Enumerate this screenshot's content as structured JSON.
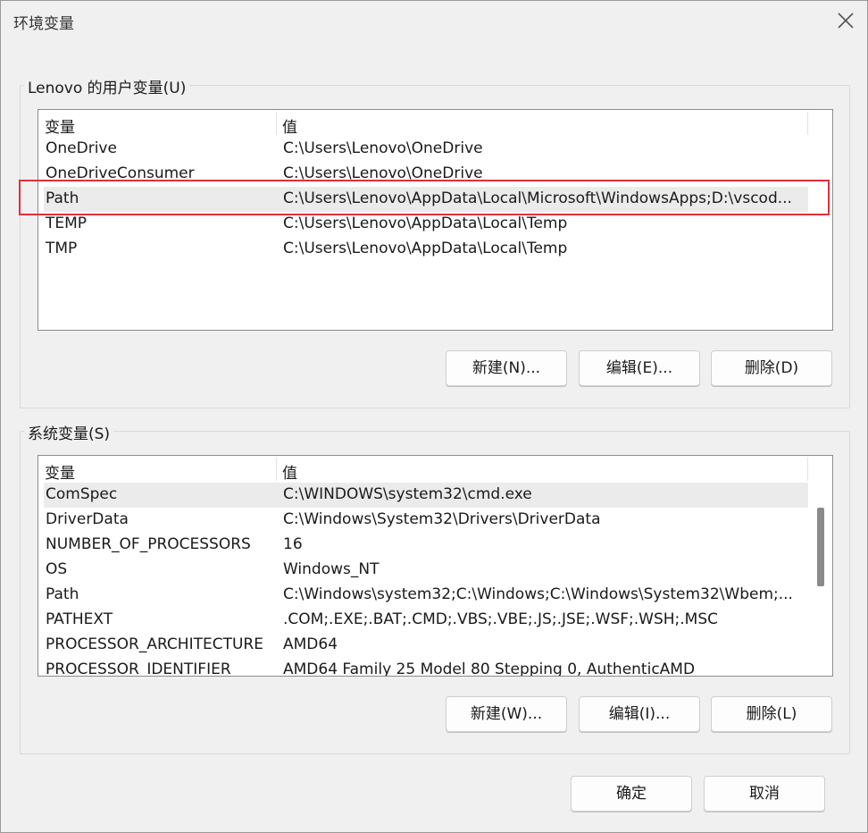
{
  "window": {
    "title": "环境变量"
  },
  "user_vars": {
    "group_label": "Lenovo 的用户变量(U)",
    "col_variable": "变量",
    "col_value": "值",
    "rows": [
      {
        "name": "OneDrive",
        "value": "C:\\Users\\Lenovo\\OneDrive"
      },
      {
        "name": "OneDriveConsumer",
        "value": "C:\\Users\\Lenovo\\OneDrive"
      },
      {
        "name": "Path",
        "value": "C:\\Users\\Lenovo\\AppData\\Local\\Microsoft\\WindowsApps;D:\\vscod..."
      },
      {
        "name": "TEMP",
        "value": "C:\\Users\\Lenovo\\AppData\\Local\\Temp"
      },
      {
        "name": "TMP",
        "value": "C:\\Users\\Lenovo\\AppData\\Local\\Temp"
      }
    ],
    "new_label": "新建(N)...",
    "edit_label": "编辑(E)...",
    "delete_label": "删除(D)"
  },
  "system_vars": {
    "group_label": "系统变量(S)",
    "col_variable": "变量",
    "col_value": "值",
    "rows": [
      {
        "name": "ComSpec",
        "value": "C:\\WINDOWS\\system32\\cmd.exe"
      },
      {
        "name": "DriverData",
        "value": "C:\\Windows\\System32\\Drivers\\DriverData"
      },
      {
        "name": "NUMBER_OF_PROCESSORS",
        "value": "16"
      },
      {
        "name": "OS",
        "value": "Windows_NT"
      },
      {
        "name": "Path",
        "value": "C:\\Windows\\system32;C:\\Windows;C:\\Windows\\System32\\Wbem;..."
      },
      {
        "name": "PATHEXT",
        "value": ".COM;.EXE;.BAT;.CMD;.VBS;.VBE;.JS;.JSE;.WSF;.WSH;.MSC"
      },
      {
        "name": "PROCESSOR_ARCHITECTURE",
        "value": "AMD64"
      },
      {
        "name": "PROCESSOR_IDENTIFIER",
        "value": "AMD64 Family 25 Model 80 Stepping 0, AuthenticAMD"
      }
    ],
    "new_label": "新建(W)...",
    "edit_label": "编辑(I)...",
    "delete_label": "删除(L)"
  },
  "footer": {
    "ok_label": "确定",
    "cancel_label": "取消"
  },
  "icons": {
    "close": "close-icon"
  },
  "colors": {
    "highlight": "#e0303a",
    "selected_row": "#ebebeb"
  }
}
